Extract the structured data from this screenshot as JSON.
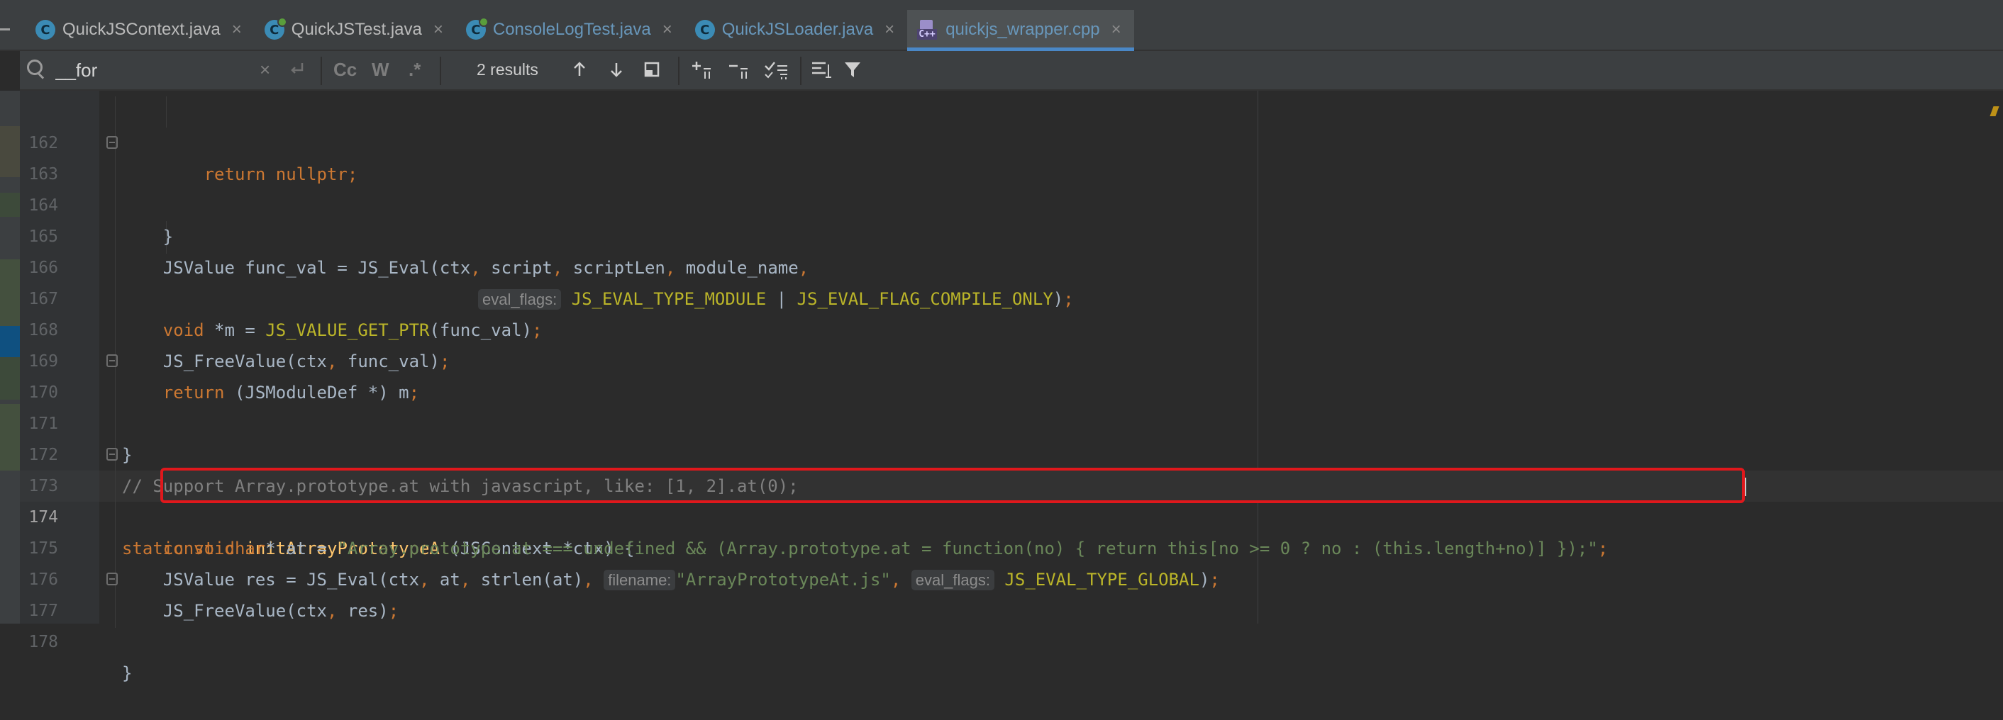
{
  "tabs": [
    {
      "name": "QuickJSContext.java",
      "icon": "java-class-icon",
      "test": false,
      "modified": false,
      "active": false
    },
    {
      "name": "QuickJSTest.java",
      "icon": "java-class-icon",
      "test": true,
      "modified": false,
      "active": false
    },
    {
      "name": "ConsoleLogTest.java",
      "icon": "java-class-icon",
      "test": true,
      "modified": true,
      "active": false
    },
    {
      "name": "QuickJSLoader.java",
      "icon": "java-class-icon",
      "test": false,
      "modified": true,
      "active": false
    },
    {
      "name": "quickjs_wrapper.cpp",
      "icon": "cpp-file-icon",
      "test": false,
      "modified": true,
      "active": true
    }
  ],
  "tab_close_glyph": "×",
  "cpp_icon_label": "C++",
  "find": {
    "query": "__for",
    "results": "2 results",
    "match_case": "Cc",
    "words": "W",
    "regex": ".*",
    "clear": "×"
  },
  "gutter": {
    "current_line": "174"
  },
  "code_lines": [
    {
      "ln": "162",
      "text": "        return nullptr;"
    },
    {
      "ln": "163",
      "text": "    }"
    },
    {
      "ln": "164",
      "text": ""
    },
    {
      "ln": "165",
      "text": "    JSValue func_val = JS_Eval(ctx, script, scriptLen, module_name,"
    },
    {
      "ln": "166",
      "hint": "eval_flags:",
      "text": "JS_EVAL_TYPE_MODULE | JS_EVAL_FLAG_COMPILE_ONLY);"
    },
    {
      "ln": "167",
      "text": "    void *m = JS_VALUE_GET_PTR(func_val);"
    },
    {
      "ln": "168",
      "text": "    JS_FreeValue(ctx, func_val);"
    },
    {
      "ln": "169",
      "text": "    return (JSModuleDef *) m;"
    },
    {
      "ln": "170",
      "text": "}"
    },
    {
      "ln": "171",
      "text": ""
    },
    {
      "ln": "172",
      "text": "// Support Array.prototype.at with javascript, like: [1, 2].at(0);"
    },
    {
      "ln": "173",
      "text": "static void initArrayPrototypeAt(JSContext *ctx) {"
    },
    {
      "ln": "174",
      "text": "    const char* at = \"Array.prototype.at === undefined && (Array.prototype.at = function(no) { return this[no >= 0 ? no : (this.length+no)] });\";"
    },
    {
      "ln": "175",
      "hint_filename": "filename:",
      "hint_flags": "eval_flags:",
      "text": "    JSValue res = JS_Eval(ctx, at, strlen(at), \"ArrayPrototypeAt.js\", JS_EVAL_TYPE_GLOBAL);"
    },
    {
      "ln": "176",
      "text": "    JS_FreeValue(ctx, res);"
    },
    {
      "ln": "177",
      "text": "}"
    },
    {
      "ln": "178",
      "text": ""
    }
  ],
  "colors": {
    "keyword": "#cc7832",
    "macro": "#bbb529",
    "function": "#ffc66d",
    "string": "#6a8759",
    "comment": "#808080",
    "highlight_box": "#e0181c",
    "active_tab_underline": "#4a88c7"
  }
}
